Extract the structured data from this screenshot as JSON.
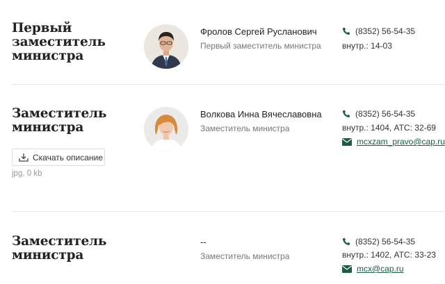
{
  "colors": {
    "accent": "#1a5c44",
    "divider": "#e6e6e6",
    "muted": "#777777"
  },
  "sections": [
    {
      "role_title": "Первый\nзаместитель\nминистра",
      "name": "Фролов Сергей Русланович",
      "position": "Первый заместитель министра",
      "phone": "(8352) 56-54-35",
      "ext": "внутр.: 14-03",
      "has_photo": true
    },
    {
      "role_title": "Заместитель\nминистра",
      "name": "Волкова Инна Вячеславовна",
      "position": "Заместитель министра",
      "phone": "(8352) 56-54-35",
      "ext": "внутр.: 1404, АТС: 32-69",
      "email": "mcxzam_pravo@cap.ru",
      "has_photo": true,
      "download": {
        "label": "Скачать описание",
        "meta": "jpg, 0 kb"
      }
    },
    {
      "role_title": "Заместитель\nминистра",
      "name": "--",
      "position": "Заместитель министра",
      "phone": "(8352) 56-54-35",
      "ext": "внутр.: 1402, АТС: 33-23",
      "email": "mcx@cap.ru",
      "has_photo": false
    }
  ],
  "icons": {
    "phone": "phone-icon",
    "email": "envelope-icon",
    "download": "download-icon"
  }
}
